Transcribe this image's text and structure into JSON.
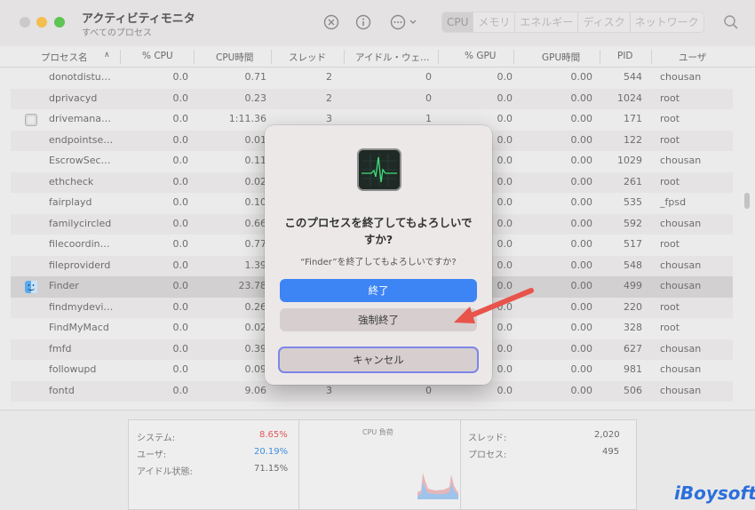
{
  "window": {
    "title": "アクティビティモニタ",
    "subtitle": "すべてのプロセス"
  },
  "toolbar": {
    "icons": [
      "stop-icon",
      "info-icon",
      "more-icon"
    ],
    "tabs": [
      {
        "label": "CPU",
        "active": true
      },
      {
        "label": "メモリ",
        "active": false
      },
      {
        "label": "エネルギー",
        "active": false
      },
      {
        "label": "ディスク",
        "active": false
      },
      {
        "label": "ネットワーク",
        "active": false
      }
    ],
    "search_icon": "search-icon"
  },
  "table": {
    "columns": [
      "プロセス名",
      "% CPU",
      "CPU時間",
      "スレッド",
      "アイドル・ウェ…",
      "% GPU",
      "GPU時間",
      "PID",
      "ユーザ"
    ],
    "rows": [
      {
        "name": "donotdistu…",
        "cpu": "0.0",
        "time": "0.71",
        "threads": "2",
        "idle": "0",
        "gpu": "0.0",
        "gputime": "0.00",
        "pid": "544",
        "user": "chousan"
      },
      {
        "name": "dprivacyd",
        "cpu": "0.0",
        "time": "0.23",
        "threads": "2",
        "idle": "0",
        "gpu": "0.0",
        "gputime": "0.00",
        "pid": "1024",
        "user": "root"
      },
      {
        "name": "drivemana…",
        "cpu": "0.0",
        "time": "1:11.36",
        "threads": "3",
        "idle": "1",
        "gpu": "0.0",
        "gputime": "0.00",
        "pid": "171",
        "user": "root",
        "icon": "app-icon"
      },
      {
        "name": "endpointse…",
        "cpu": "0.0",
        "time": "0.01",
        "threads": "",
        "idle": "",
        "gpu": "0.0",
        "gputime": "0.00",
        "pid": "122",
        "user": "root"
      },
      {
        "name": "EscrowSec…",
        "cpu": "0.0",
        "time": "0.11",
        "threads": "",
        "idle": "",
        "gpu": "0.0",
        "gputime": "0.00",
        "pid": "1029",
        "user": "chousan"
      },
      {
        "name": "ethcheck",
        "cpu": "0.0",
        "time": "0.02",
        "threads": "",
        "idle": "",
        "gpu": "0.0",
        "gputime": "0.00",
        "pid": "261",
        "user": "root"
      },
      {
        "name": "fairplayd",
        "cpu": "0.0",
        "time": "0.10",
        "threads": "",
        "idle": "",
        "gpu": "0.0",
        "gputime": "0.00",
        "pid": "535",
        "user": "_fpsd"
      },
      {
        "name": "familycircled",
        "cpu": "0.0",
        "time": "0.66",
        "threads": "",
        "idle": "",
        "gpu": "0.0",
        "gputime": "0.00",
        "pid": "592",
        "user": "chousan"
      },
      {
        "name": "filecoordin…",
        "cpu": "0.0",
        "time": "0.77",
        "threads": "",
        "idle": "",
        "gpu": "0.0",
        "gputime": "0.00",
        "pid": "517",
        "user": "root"
      },
      {
        "name": "fileproviderd",
        "cpu": "0.0",
        "time": "1.39",
        "threads": "",
        "idle": "",
        "gpu": "0.0",
        "gputime": "0.00",
        "pid": "548",
        "user": "chousan"
      },
      {
        "name": "Finder",
        "cpu": "0.0",
        "time": "23.78",
        "threads": "",
        "idle": "",
        "gpu": "0.0",
        "gputime": "0.00",
        "pid": "499",
        "user": "chousan",
        "icon": "finder-icon",
        "selected": true
      },
      {
        "name": "findmydevi…",
        "cpu": "0.0",
        "time": "0.26",
        "threads": "",
        "idle": "",
        "gpu": "0.0",
        "gputime": "0.00",
        "pid": "220",
        "user": "root"
      },
      {
        "name": "FindMyMacd",
        "cpu": "0.0",
        "time": "0.02",
        "threads": "",
        "idle": "",
        "gpu": "0.0",
        "gputime": "0.00",
        "pid": "328",
        "user": "root"
      },
      {
        "name": "fmfd",
        "cpu": "0.0",
        "time": "0.39",
        "threads": "",
        "idle": "",
        "gpu": "0.0",
        "gputime": "0.00",
        "pid": "627",
        "user": "chousan"
      },
      {
        "name": "followupd",
        "cpu": "0.0",
        "time": "0.09",
        "threads": "",
        "idle": "",
        "gpu": "0.0",
        "gputime": "0.00",
        "pid": "981",
        "user": "chousan"
      },
      {
        "name": "fontd",
        "cpu": "0.0",
        "time": "9.06",
        "threads": "3",
        "idle": "0",
        "gpu": "0.0",
        "gputime": "0.00",
        "pid": "506",
        "user": "chousan"
      }
    ]
  },
  "stats": {
    "system_label": "システム:",
    "system_value": "8.65%",
    "user_label": "ユーザ:",
    "user_value": "20.19%",
    "idle_label": "アイドル状態:",
    "idle_value": "71.15%",
    "cpu_load_title": "CPU 負荷",
    "threads_label": "スレッド:",
    "threads_value": "2,020",
    "processes_label": "プロセス:",
    "processes_value": "495",
    "system_color": "#e0575b",
    "user_color": "#3d8fe0"
  },
  "dialog": {
    "title_line1": "このプロセスを終了してもよろしいで",
    "title_line2": "すか?",
    "message": "“Finder”を終了してもよろしいですか?",
    "quit_label": "終了",
    "force_quit_label": "強制終了",
    "cancel_label": "キャンセル",
    "icon": "activity-monitor-icon",
    "primary_color": "#3d84f5"
  },
  "annotation": {
    "arrow_color": "#e8534a"
  },
  "watermark": "iBoysoft"
}
